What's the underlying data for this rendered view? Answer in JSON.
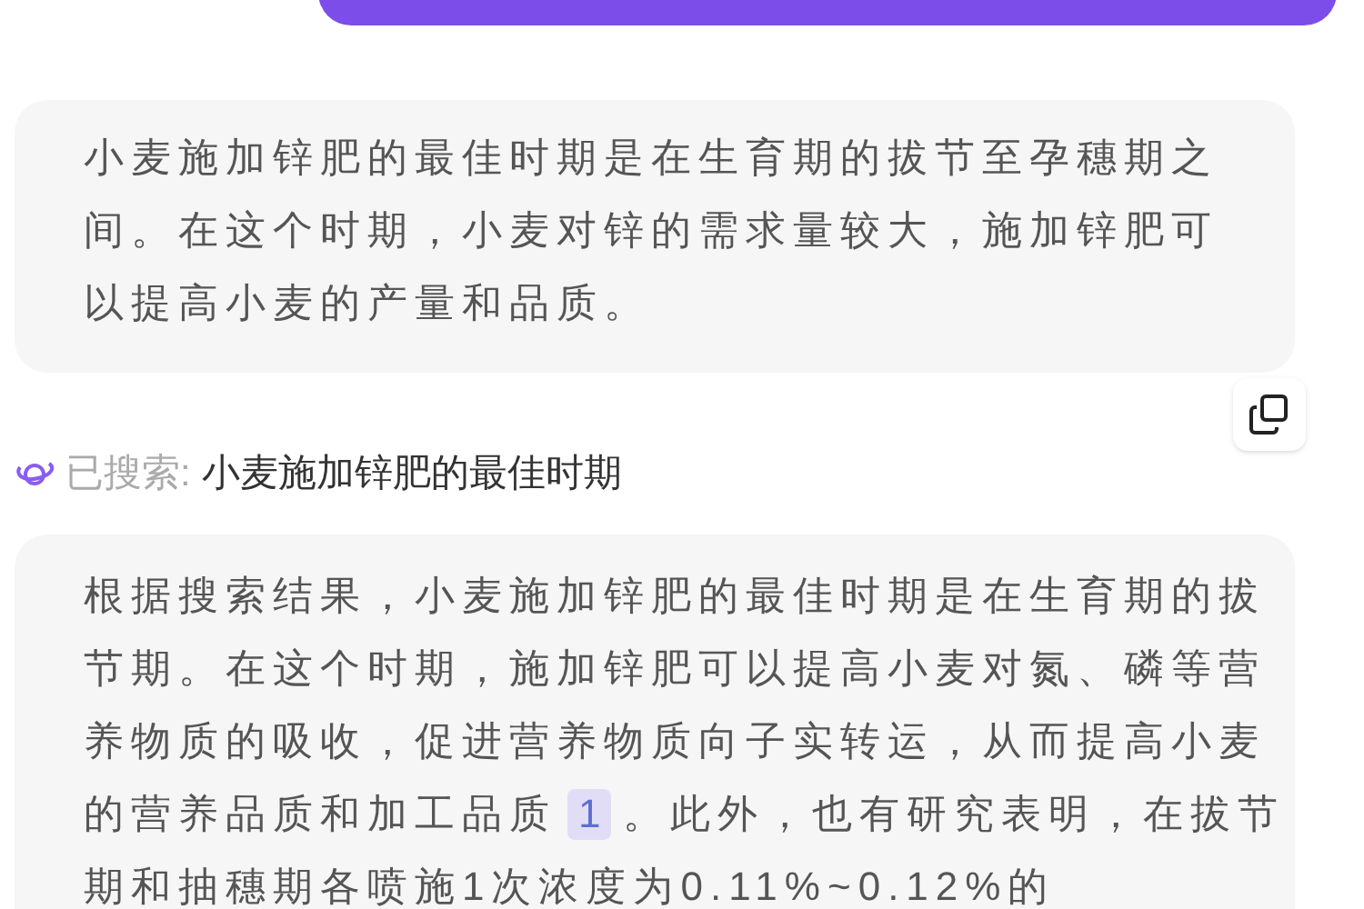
{
  "answer": {
    "text": "小麦施加锌肥的最佳时期是在生育期的拔节至孕穗期之间。在这个时期，小麦对锌的需求量较大，施加锌肥可以提高小麦的产量和品质。"
  },
  "search": {
    "label": "已搜索:",
    "query": "小麦施加锌肥的最佳时期"
  },
  "result": {
    "before": "根据搜索结果，小麦施加锌肥的最佳时期是在生育期的拔节期。在这个时期，施加锌肥可以提高小麦对氮、磷等营养物质的吸收，促进营养物质向子实转运，从而提高小麦的营养品质和加工品质",
    "citation": "1",
    "after": "。此外，也有研究表明，在拔节期和抽穗期各喷施1次浓度为0.11%~0.12%的"
  }
}
